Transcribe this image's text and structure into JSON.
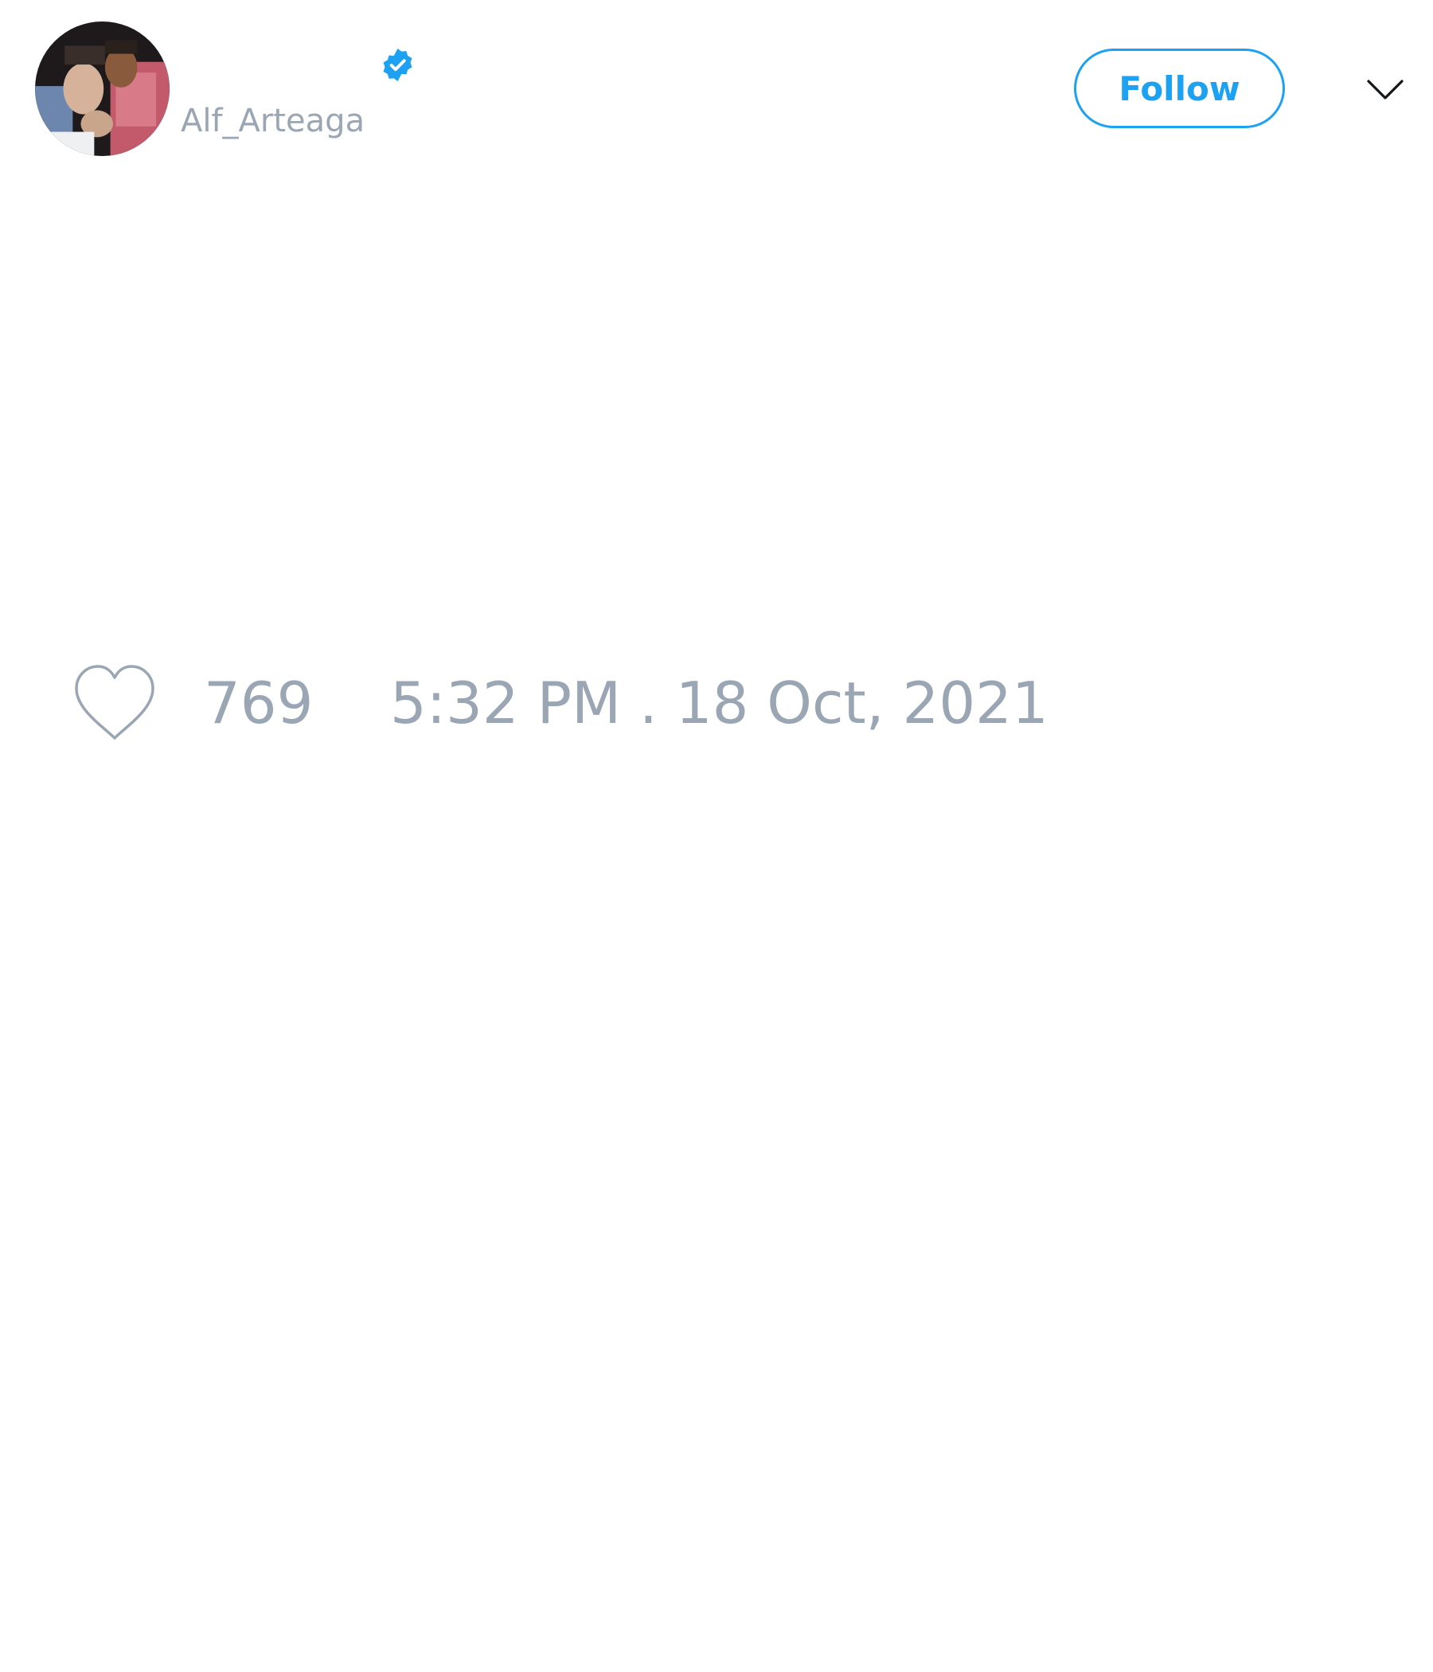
{
  "tweet": {
    "author": {
      "display_name": "",
      "handle": "Alf_Arteaga",
      "avatar_icon": "profile-photo",
      "verified": true,
      "verified_icon": "verified-badge-icon"
    },
    "follow_button": {
      "label": "Follow"
    },
    "menu_icon": "chevron-down-icon",
    "like_icon": "heart-outline-icon",
    "like_count": "769",
    "timestamp": "5:32 PM . 18 Oct, 2021"
  },
  "colors": {
    "accent": "#1da1f2",
    "muted_text": "#9aa6b4",
    "background": "#ffffff"
  }
}
